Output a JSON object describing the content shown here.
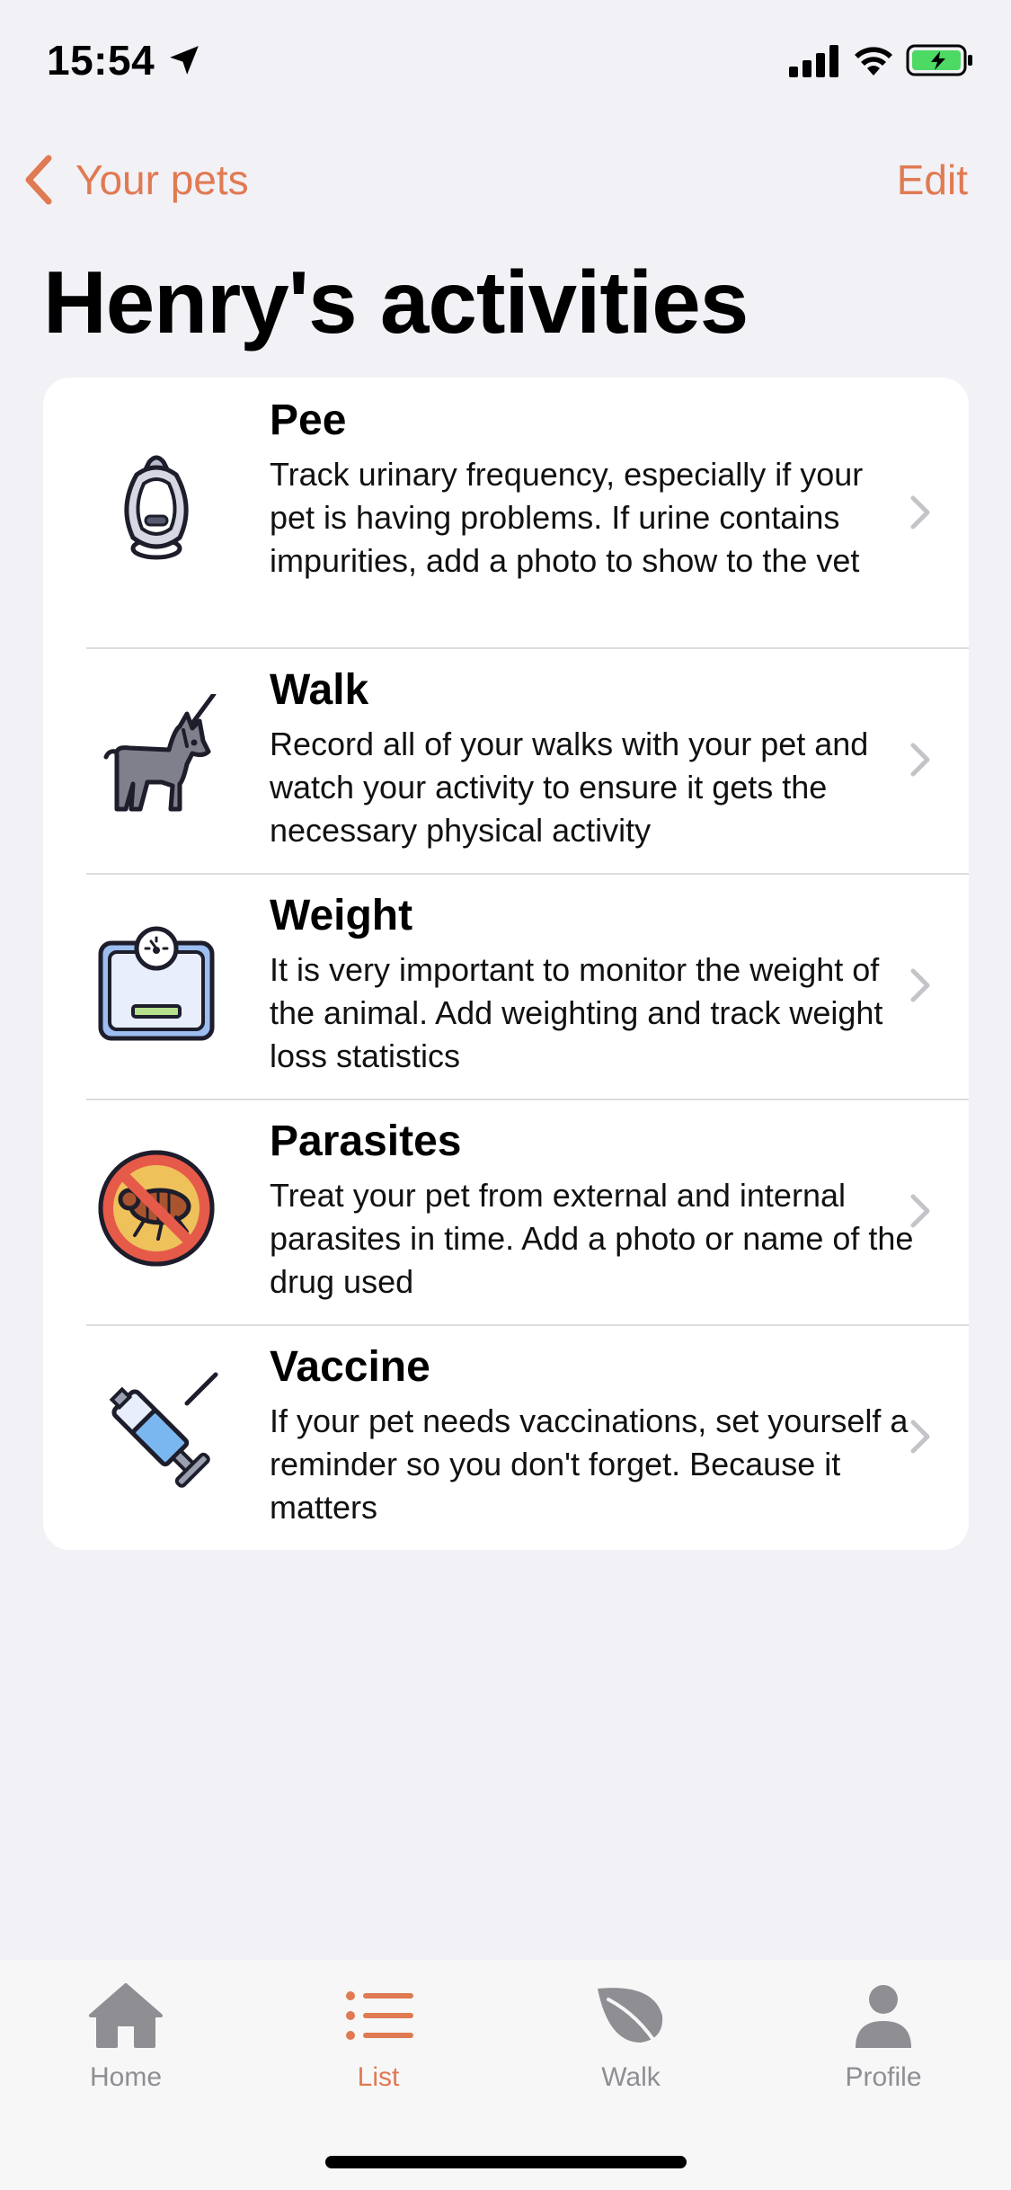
{
  "status": {
    "time": "15:54"
  },
  "nav": {
    "back_label": "Your pets",
    "edit_label": "Edit"
  },
  "page": {
    "title": "Henry's activities"
  },
  "activities": [
    {
      "title": "Pee",
      "description": "Track urinary frequency, especially if your pet is having problems. If urine contains impurities, add a photo to show to the vet",
      "icon": "urinal-icon"
    },
    {
      "title": "Walk",
      "description": "Record all of your walks with your pet and watch your activity to ensure it gets the necessary physical activity",
      "icon": "dog-leash-icon"
    },
    {
      "title": "Weight",
      "description": "It is very important to monitor the weight of the animal. Add weighting and track weight loss statistics",
      "icon": "scale-icon"
    },
    {
      "title": "Parasites",
      "description": "Treat your pet from external and internal parasites in time. Add a photo or name of the drug used",
      "icon": "no-flea-icon"
    },
    {
      "title": "Vaccine",
      "description": "If your pet needs vaccinations, set yourself a reminder so you don't forget. Because it matters",
      "icon": "syringe-icon"
    }
  ],
  "tabs": [
    {
      "label": "Home",
      "icon": "house-icon"
    },
    {
      "label": "List",
      "icon": "list-icon",
      "active": true
    },
    {
      "label": "Walk",
      "icon": "leaf-icon"
    },
    {
      "label": "Profile",
      "icon": "person-icon"
    }
  ],
  "colors": {
    "accent": "#e07a52",
    "inactive": "#8e8e93",
    "background": "#f2f1f6"
  }
}
